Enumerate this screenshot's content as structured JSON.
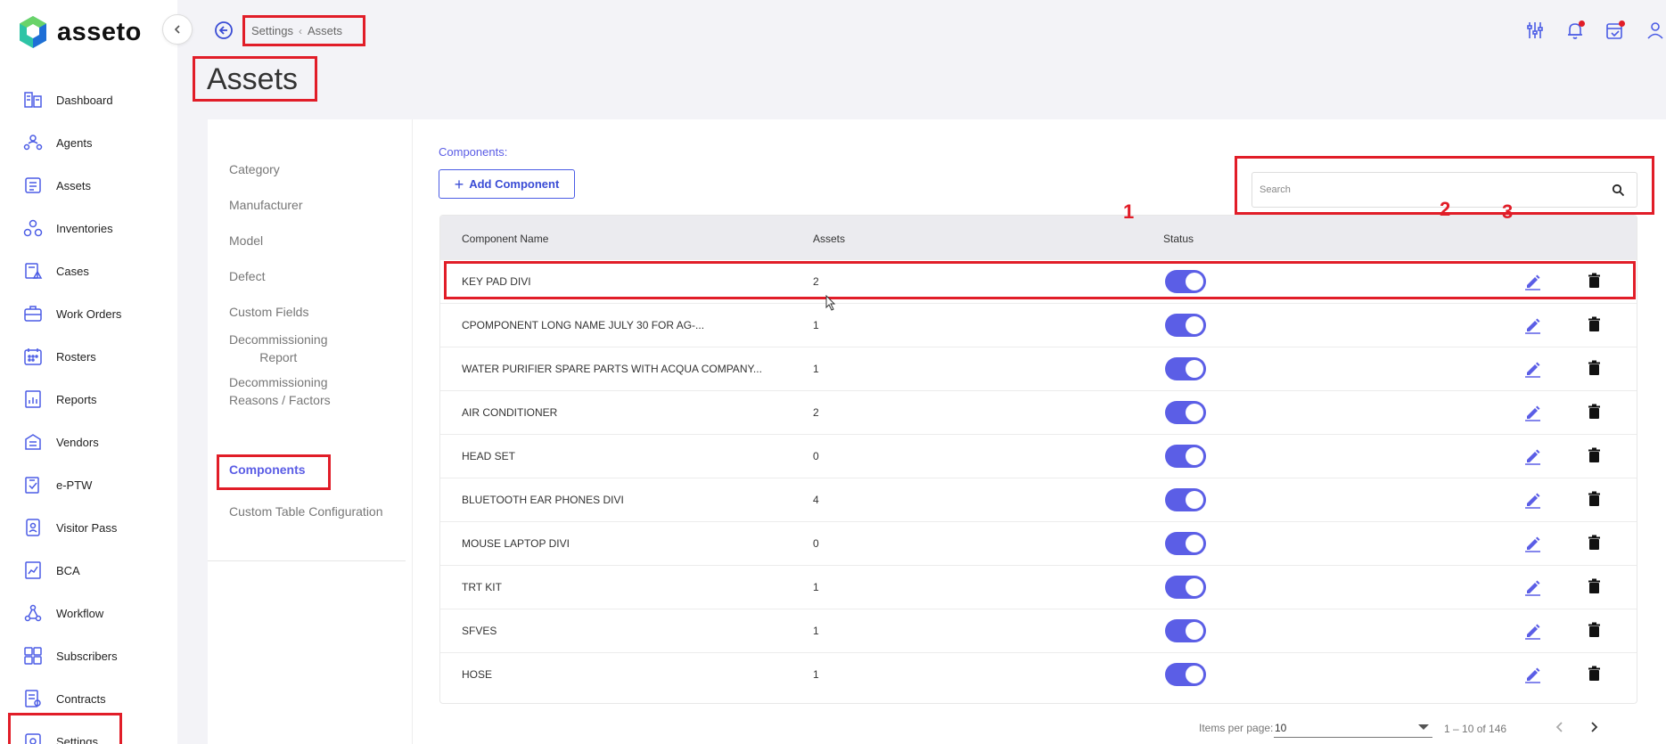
{
  "app": {
    "name": "asseto"
  },
  "sidebar": {
    "items": [
      {
        "label": "Dashboard",
        "icon": "dashboard-icon"
      },
      {
        "label": "Agents",
        "icon": "agents-icon"
      },
      {
        "label": "Assets",
        "icon": "assets-icon"
      },
      {
        "label": "Inventories",
        "icon": "inventories-icon"
      },
      {
        "label": "Cases",
        "icon": "cases-icon"
      },
      {
        "label": "Work Orders",
        "icon": "work-orders-icon"
      },
      {
        "label": "Rosters",
        "icon": "rosters-icon"
      },
      {
        "label": "Reports",
        "icon": "reports-icon"
      },
      {
        "label": "Vendors",
        "icon": "vendors-icon"
      },
      {
        "label": "e-PTW",
        "icon": "eptw-icon"
      },
      {
        "label": "Visitor Pass",
        "icon": "visitor-pass-icon"
      },
      {
        "label": "BCA",
        "icon": "bca-icon"
      },
      {
        "label": "Workflow",
        "icon": "workflow-icon"
      },
      {
        "label": "Subscribers",
        "icon": "subscribers-icon"
      },
      {
        "label": "Contracts",
        "icon": "contracts-icon"
      },
      {
        "label": "Settings",
        "icon": "settings-icon"
      }
    ]
  },
  "header": {
    "breadcrumb": [
      "Settings",
      "Assets"
    ],
    "title": "Assets",
    "icons": [
      "sliders-icon",
      "bell-alert-icon",
      "calendar-check-icon",
      "user-icon"
    ]
  },
  "submenu": {
    "items": [
      {
        "label": "Category"
      },
      {
        "label": "Manufacturer"
      },
      {
        "label": "Model"
      },
      {
        "label": "Defect"
      },
      {
        "label": "Custom Fields"
      },
      {
        "label_line1": "Decommissioning",
        "label_line2": "Report"
      },
      {
        "label_line1": "Decommissioning",
        "label_line2": "Reasons / Factors"
      },
      {
        "label": "Components",
        "active": true
      },
      {
        "label": "Custom Table Configuration"
      }
    ]
  },
  "components": {
    "section_label": "Components:",
    "add_button": "Add Component",
    "search_placeholder": "Search",
    "columns": [
      "Component Name",
      "Assets",
      "Status"
    ],
    "rows": [
      {
        "name": "KEY PAD DIVI",
        "assets": "2",
        "status": true
      },
      {
        "name": "CPOMPONENT LONG NAME JULY 30 FOR AG-...",
        "assets": "1",
        "status": true
      },
      {
        "name": "WATER PURIFIER SPARE PARTS WITH ACQUA COMPANY...",
        "assets": "1",
        "status": true
      },
      {
        "name": "AIR CONDITIONER",
        "assets": "2",
        "status": true
      },
      {
        "name": "HEAD SET",
        "assets": "0",
        "status": true
      },
      {
        "name": "BLUETOOTH EAR PHONES DIVI",
        "assets": "4",
        "status": true
      },
      {
        "name": "MOUSE LAPTOP DIVI",
        "assets": "0",
        "status": true
      },
      {
        "name": "TRT KIT",
        "assets": "1",
        "status": true
      },
      {
        "name": "SFVES",
        "assets": "1",
        "status": true
      },
      {
        "name": "HOSE",
        "assets": "1",
        "status": true
      }
    ]
  },
  "annotations": [
    "1",
    "2",
    "3"
  ],
  "pagination": {
    "items_per_page_label": "Items per page:",
    "items_per_page": "10",
    "range": "1 – 10 of 146"
  },
  "colors": {
    "accent": "#5b5ee6",
    "highlight": "#e11d28"
  }
}
